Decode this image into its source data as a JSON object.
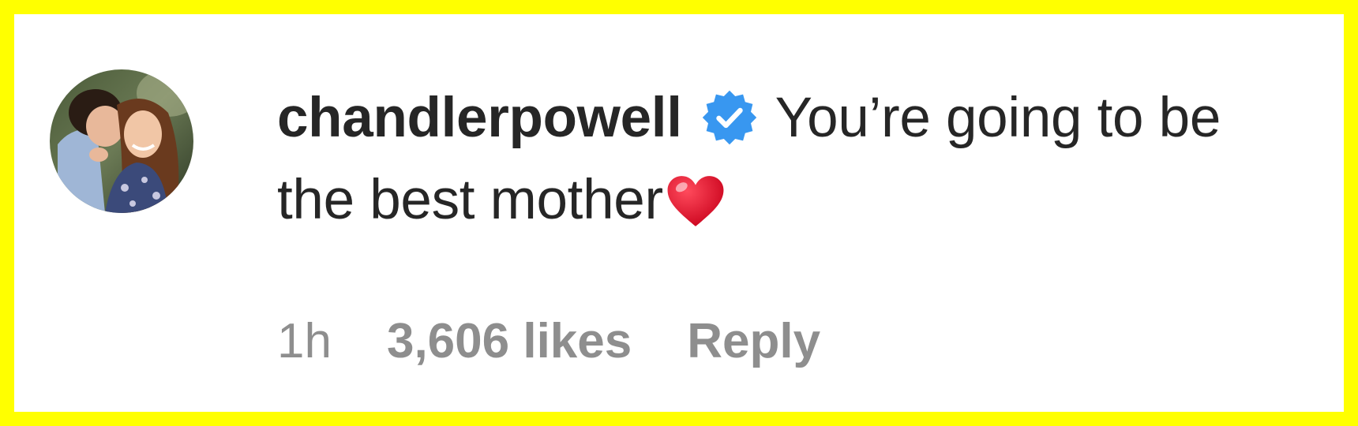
{
  "comment": {
    "username": "chandlerpowell",
    "verified_icon": "verified-badge-icon",
    "text": "You’re going to be the best mother",
    "emoji": "heart-emoji-icon"
  },
  "meta": {
    "time": "1h",
    "likes": "3,606 likes",
    "reply": "Reply"
  },
  "colors": {
    "border": "#ffff00",
    "text": "#262626",
    "meta_text": "#8e8e8e",
    "verified": "#3897f0",
    "heart": "#e0102a"
  }
}
